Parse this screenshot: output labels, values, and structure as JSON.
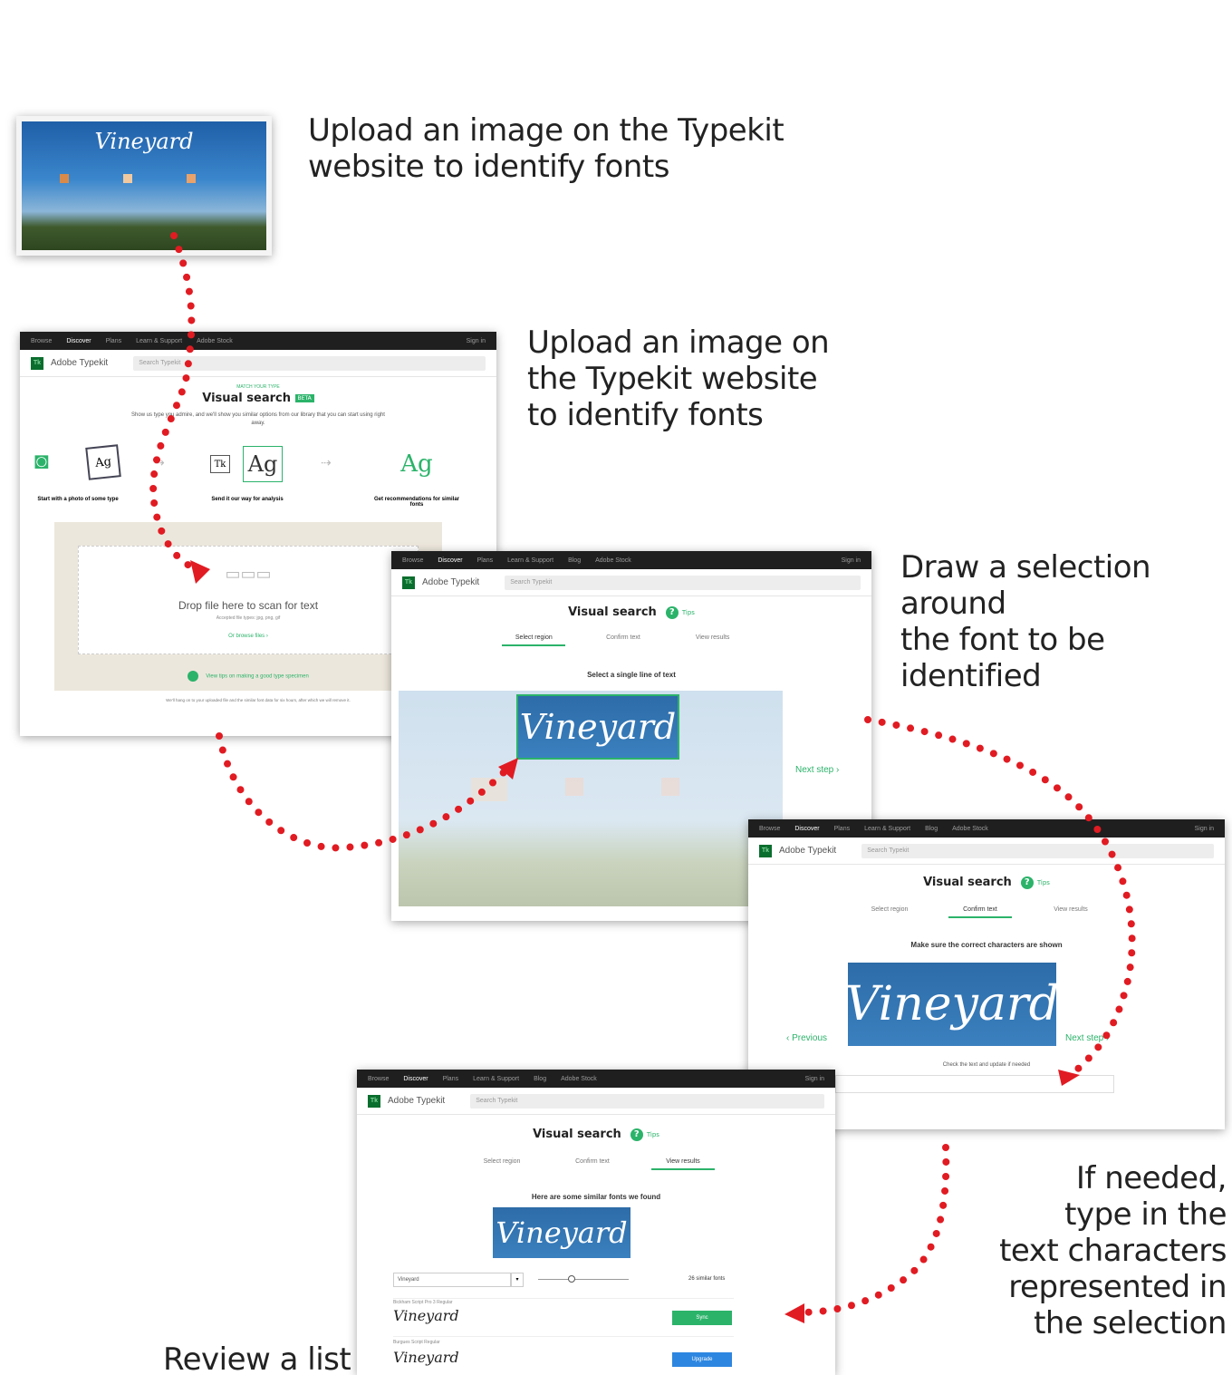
{
  "captions": {
    "c1": "Upload an image on the Typekit\nwebsite to identify fonts",
    "c2": "Upload an image on\nthe Typekit website\nto identify fonts",
    "c3": "Draw a selection around\nthe font to be identified",
    "c4": "If needed,\ntype in the\ntext characters\nrepresented in\nthe selection",
    "c5": "Review a list"
  },
  "shot1": {
    "logo_text": "Vineyard"
  },
  "typekit": {
    "brand": "Adobe Typekit",
    "search_placeholder": "Search Typekit",
    "nav": [
      "Browse",
      "Discover",
      "Plans",
      "Learn & Support",
      "Blog",
      "Adobe Stock"
    ],
    "sign_in": "Sign in"
  },
  "shot2": {
    "kicker": "Match Your Type",
    "title": "Visual search",
    "badge": "BETA",
    "intro": "Show us type you admire, and we'll show you similar options from our library that you can start using right away.",
    "step_captions": [
      "Start with a photo of some type",
      "Send it our way for analysis",
      "Get recommendations for similar fonts"
    ],
    "drop_text": "Drop file here to scan for text",
    "accepted": "Accepted file types: jpg, png, gif",
    "browse": "Or browse files ›",
    "tips_link": "View tips on making a good type specimen",
    "footnote": "We'll hang on to your uploaded file and the similar font data for six hours, after which we will remove it."
  },
  "shot3": {
    "title": "Visual search",
    "tips": "Tips",
    "steps": [
      "Select region",
      "Confirm text",
      "View results"
    ],
    "instruction": "Select a single line of text",
    "selection_text": "Vineyard",
    "next": "Next step ›"
  },
  "shot4": {
    "title": "Visual search",
    "tips": "Tips",
    "steps": [
      "Select region",
      "Confirm text",
      "View results"
    ],
    "instruction": "Make sure the correct characters are shown",
    "selection_text": "Vineyard",
    "previous": "‹ Previous",
    "next": "Next step ›",
    "check": "Check the text and update if needed"
  },
  "shot5": {
    "title": "Visual search",
    "tips": "Tips",
    "steps": [
      "Select region",
      "Confirm text",
      "View results"
    ],
    "instruction": "Here are some similar fonts we found",
    "selection_text": "Vineyard",
    "sample_input": "Vineyard",
    "count": "26 similar fonts",
    "results": [
      {
        "name": "Bickham Script Pro 3 Regular",
        "sample": "Vineyard",
        "action": "Sync",
        "color": "#2bb36a"
      },
      {
        "name": "Burgues Script Regular",
        "sample": "Vineyard",
        "action": "Upgrade",
        "color": "#2d86e0"
      }
    ]
  },
  "colors": {
    "accent": "#2bb36a",
    "arrow": "#e11b22",
    "dark_bar": "#1f1f1f",
    "photo_blue": "#2d6ca8"
  }
}
